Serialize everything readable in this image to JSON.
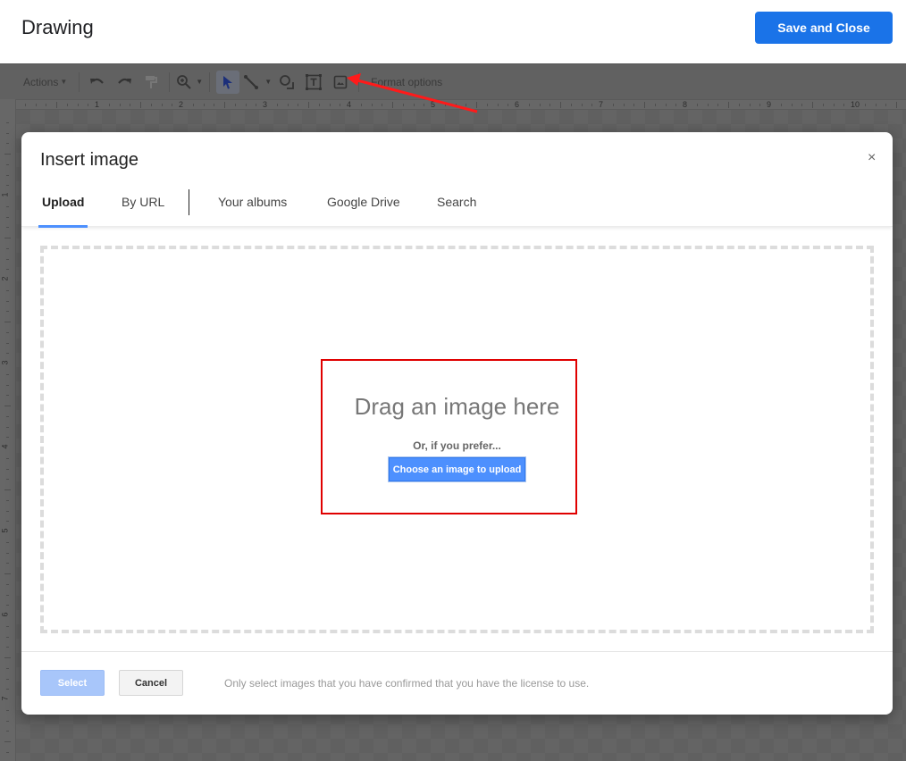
{
  "app": {
    "title": "Drawing",
    "save_close_label": "Save and Close",
    "brand_color": "#1a73e8"
  },
  "toolbar": {
    "actions_label": "Actions",
    "format_options_label": "Format options",
    "icons": [
      "undo-icon",
      "redo-icon",
      "paint-format-icon",
      "zoom-icon",
      "select-pointer-icon",
      "line-icon",
      "shape-icon",
      "text-box-icon",
      "image-icon"
    ]
  },
  "rulers": {
    "horizontal": [
      "1",
      "2",
      "3",
      "4",
      "5",
      "6",
      "7",
      "8",
      "9",
      "10"
    ],
    "vertical": [
      "1",
      "2",
      "3",
      "4",
      "5",
      "6",
      "7"
    ]
  },
  "dialog": {
    "title": "Insert image",
    "close_glyph": "×",
    "tabs": [
      {
        "label": "Upload",
        "active": true
      },
      {
        "label": "By URL",
        "active": false
      },
      {
        "label": "Your albums",
        "active": false
      },
      {
        "label": "Google Drive",
        "active": false
      },
      {
        "label": "Search",
        "active": false
      }
    ],
    "dropzone": {
      "heading": "Drag an image here",
      "subtext": "Or, if you prefer...",
      "choose_button": "Choose an image to upload"
    },
    "footer": {
      "select_label": "Select",
      "cancel_label": "Cancel",
      "license_note": "Only select images that you have confirmed that you have the license to use."
    }
  },
  "annotations": {
    "highlight_color": "#e00000"
  }
}
